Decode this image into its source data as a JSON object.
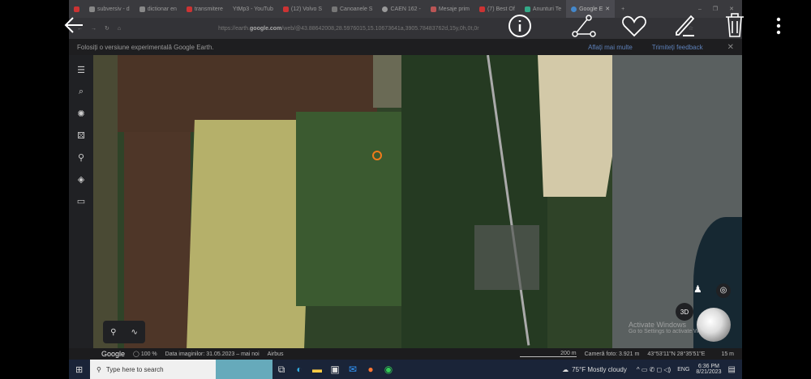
{
  "browser": {
    "tabs": [
      "subversiv - d",
      "dictionar en",
      "transmitere",
      "YtMp3 - YouTub",
      "(12) Volvo S",
      "Canoanele S",
      "CAEN 162 -",
      "Mesaje prim",
      "(7) Best Of",
      "Anunturi Te",
      "Google E"
    ],
    "url_prefix": "https://earth.",
    "url_host": "google.com",
    "url_rest": "/web/@43.88642008,28.5976015,15.10673641a,3905.78483762d,15y,0h,0t,0r"
  },
  "notice": {
    "text": "Folosiți o versiune experimentală Google Earth.",
    "learn_more": "Aflați mai multe",
    "feedback": "Trimiteți feedback"
  },
  "status": {
    "logo": "Google",
    "percent": "100 %",
    "date": "Data imaginilor: 31.05.2023 – mai noi",
    "source": "Airbus",
    "scale": "200 m",
    "camera": "Cameră foto: 3.921 m",
    "coords": "43°53'11\"N 28°35'51\"E",
    "elevation": "15 m"
  },
  "map": {
    "btn_3d": "3D",
    "watermark1": "Activate Windows",
    "watermark2": "Go to Settings to activate Windows."
  },
  "taskbar": {
    "search_placeholder": "Type here to search",
    "weather": "75°F  Mostly cloudy",
    "lang": "ENG",
    "time": "6:36 PM",
    "date": "8/21/2023"
  },
  "colors": {
    "accent": "#5d80b8",
    "marker": "#f07b1a"
  }
}
